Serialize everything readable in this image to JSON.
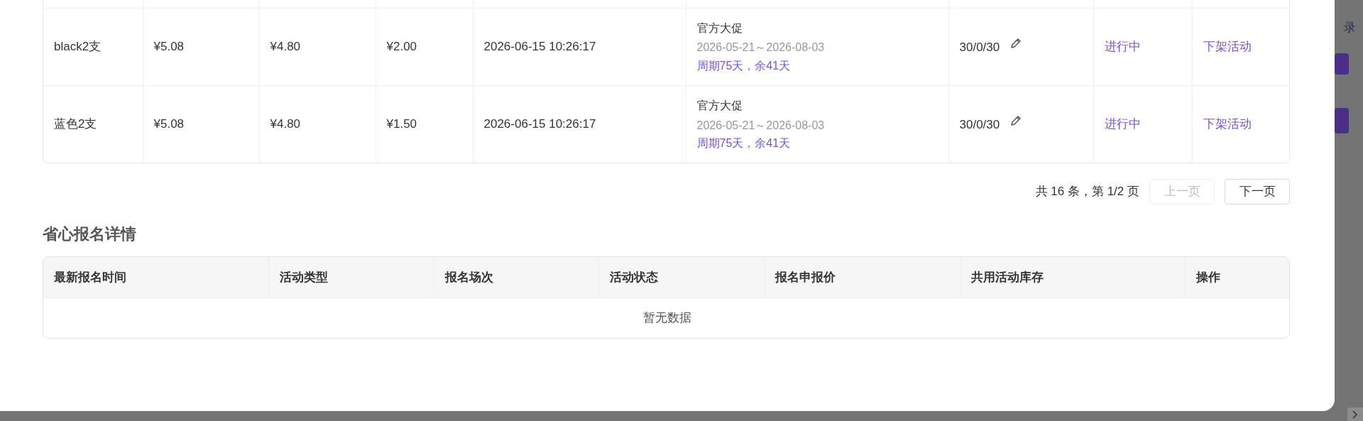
{
  "background_page": {
    "link_text": "录"
  },
  "modal": {
    "sku_table": {
      "rows": [
        {
          "column_1": "black2支",
          "column_2": "¥5.08",
          "column_3": "¥4.80",
          "column_4": "¥2.00",
          "column_5": "2026-06-15 10:26:17",
          "activity": {
            "name": "官方大促",
            "dates": "2026-05-21～2026-08-03",
            "period": "周期75天，余41天"
          },
          "column_7": "30/0/30",
          "column_8": "进行中",
          "column_9": "下架活动"
        },
        {
          "column_1": "蓝色2支",
          "column_2": "¥5.08",
          "column_3": "¥4.80",
          "column_4": "¥1.50",
          "column_5": "2026-06-15 10:26:17",
          "activity": {
            "name": "官方大促",
            "dates": "2026-05-21～2026-08-03",
            "period": "周期75天，余41天"
          },
          "column_7": "30/0/30",
          "column_8": "进行中",
          "column_9": "下架活动"
        }
      ]
    },
    "pagination": {
      "summary": "共 16 条，第 1/2 页",
      "buttons": [
        {
          "label": "上一页",
          "disabled": true
        },
        {
          "label": "下一页",
          "disabled": false
        }
      ]
    },
    "section_title": "省心报名详情",
    "signup_table": {
      "columns": [
        "最新报名时间",
        "活动类型",
        "报名场次",
        "活动状态",
        "报名申报价",
        "共用活动库存",
        "操作"
      ],
      "empty_text": "暂无数据"
    }
  }
}
